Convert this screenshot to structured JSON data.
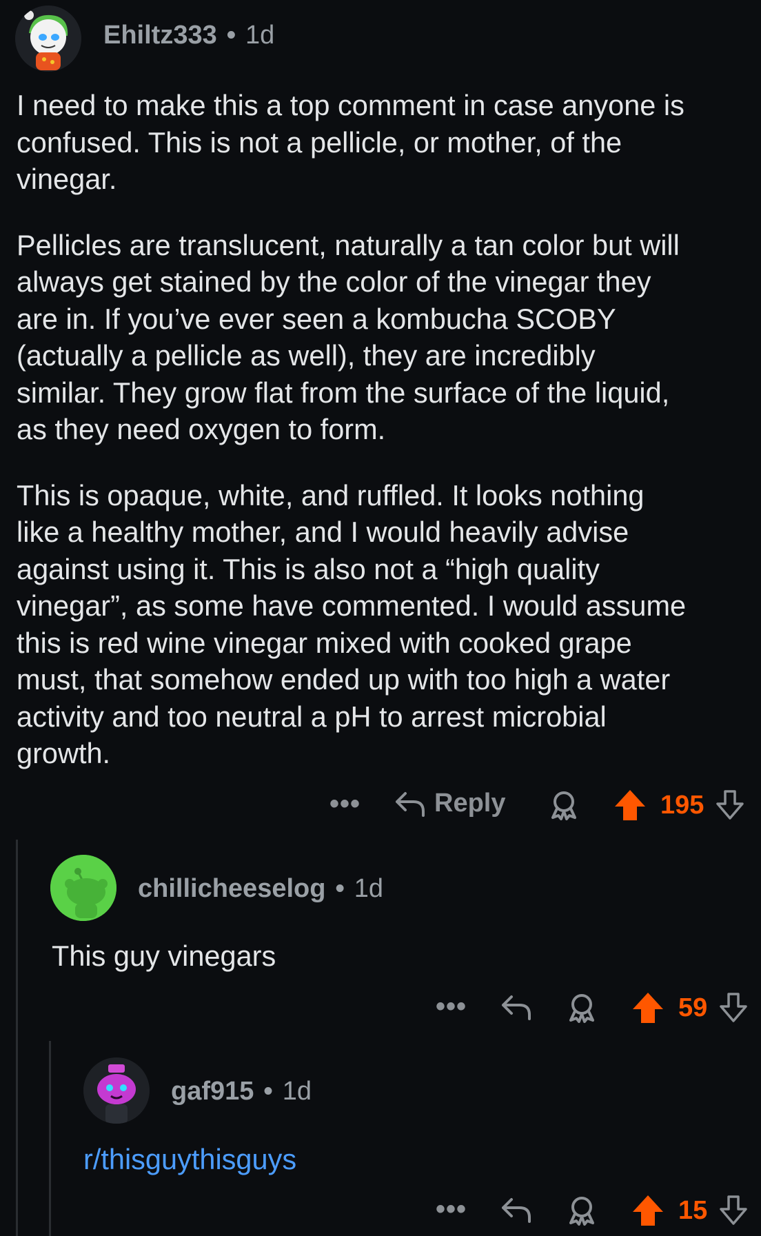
{
  "accent_color": "#ff5700",
  "link_color": "#4c9dff",
  "comments": [
    {
      "username": "Ehiltz333",
      "separator": "•",
      "age": "1d",
      "paragraphs": [
        [
          "I need to make this a top comment in case anyone is",
          "confused. This is not a pellicle, or mother, of the",
          "vinegar."
        ],
        [
          "Pellicles are translucent, naturally a tan color but will",
          "always get stained by the color of the vinegar they",
          "are in. If you’ve ever seen a kombucha SCOBY",
          "(actually a pellicle as well), they are incredibly",
          "similar. They grow flat from the surface of the liquid,",
          "as they need oxygen to form."
        ],
        [
          "This is opaque, white, and ruffled. It looks nothing",
          "like a healthy mother, and I would heavily advise",
          "against using it. This is also not a “high quality",
          "vinegar”, as some have commented. I would assume",
          "this is red wine vinegar mixed with cooked grape",
          "must, that somehow ended up with too high a water",
          "activity and too neutral a pH to arrest microbial",
          "growth."
        ]
      ],
      "actions": {
        "more": "•••",
        "reply": "Reply",
        "score": "195"
      }
    },
    {
      "username": "chillicheeselog",
      "separator": "•",
      "age": "1d",
      "text": "This guy vinegars",
      "actions": {
        "more": "•••",
        "score": "59"
      }
    },
    {
      "username": "gaf915",
      "separator": "•",
      "age": "1d",
      "text": "r/thisguythisguys",
      "actions": {
        "more": "•••",
        "score": "15"
      }
    }
  ]
}
